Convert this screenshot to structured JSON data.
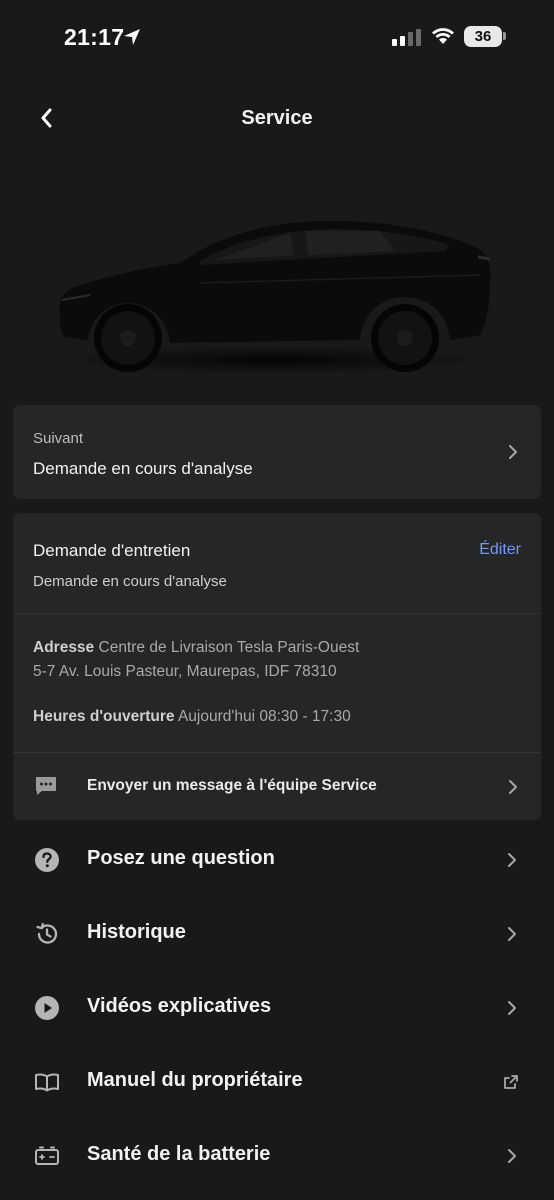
{
  "status": {
    "time": "21:17",
    "battery": "36"
  },
  "header": {
    "title": "Service"
  },
  "next": {
    "label": "Suivant",
    "value": "Demande en cours d'analyse"
  },
  "request": {
    "title": "Demande d'entretien",
    "edit": "Éditer",
    "status": "Demande en cours d'analyse",
    "address_label": "Adresse",
    "address_line1": "Centre de Livraison Tesla Paris-Ouest",
    "address_line2": "5-7 Av. Louis Pasteur, Maurepas, IDF 78310",
    "hours_label": "Heures d'ouverture",
    "hours_value": "Aujourd'hui 08:30 - 17:30",
    "message": "Envoyer un message à l'équipe Service"
  },
  "menu": [
    {
      "label": "Posez une question",
      "icon": "question-circle-icon"
    },
    {
      "label": "Historique",
      "icon": "history-icon"
    },
    {
      "label": "Vidéos explicatives",
      "icon": "play-circle-icon"
    },
    {
      "label": "Manuel du propriétaire",
      "icon": "book-icon"
    },
    {
      "label": "Santé de la batterie",
      "icon": "battery-health-icon"
    }
  ],
  "colors": {
    "background": "#18191b",
    "card": "#252628",
    "accent": "#7b97f0"
  }
}
